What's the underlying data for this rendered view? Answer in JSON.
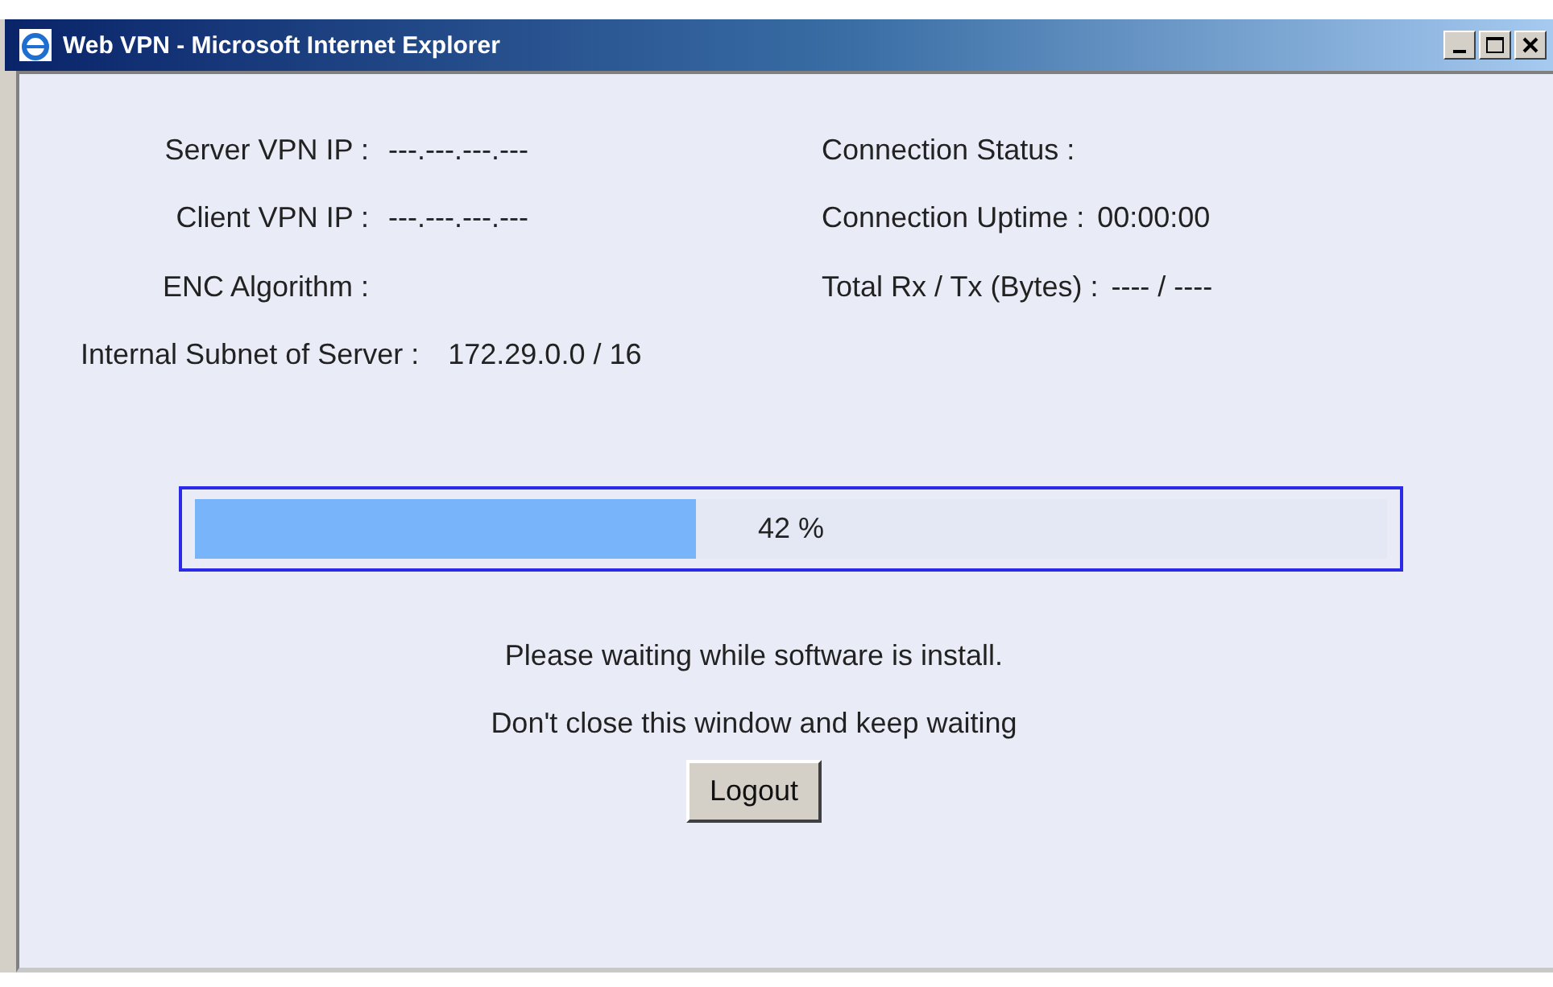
{
  "window": {
    "title": "Web VPN - Microsoft Internet Explorer"
  },
  "left_fields": [
    {
      "label": "Server VPN IP :",
      "value": "---.---.---.---"
    },
    {
      "label": "Client VPN IP :",
      "value": "---.---.---.---"
    },
    {
      "label": "ENC Algorithm :"
    }
  ],
  "subnet": {
    "label": "Internal Subnet of Server :",
    "value": "172.29.0.0 / 16"
  },
  "right_fields": [
    {
      "label": "Connection Status :"
    },
    {
      "label": "Connection Uptime :",
      "value": "00:00:00"
    },
    {
      "label": "Total Rx / Tx (Bytes) :",
      "value": "---- / ----"
    }
  ],
  "progress": {
    "level": 0.42,
    "reading": "42 %"
  },
  "messages": [
    "Please waiting while software is install.",
    "Don't close this window and keep waiting"
  ],
  "button": "Logout"
}
